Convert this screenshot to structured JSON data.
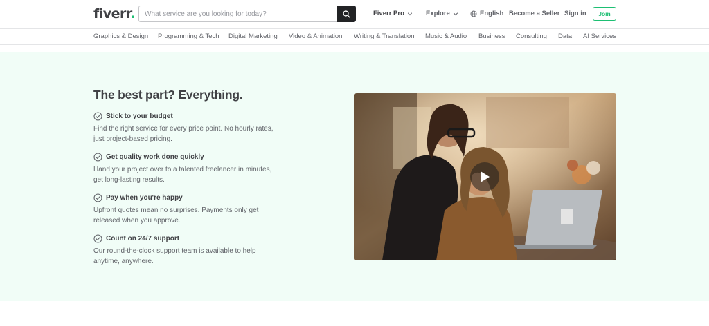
{
  "header": {
    "logo_text": "fiverr",
    "logo_dot": ".",
    "search": {
      "placeholder": "What service are you looking for today?",
      "value": ""
    },
    "nav": {
      "fiverr_pro": "Fiverr Pro",
      "explore": "Explore",
      "language": "English",
      "become_seller": "Become a Seller",
      "sign_in": "Sign in",
      "join": "Join"
    }
  },
  "categories": [
    "Graphics & Design",
    "Programming & Tech",
    "Digital Marketing",
    "Video & Animation",
    "Writing & Translation",
    "Music & Audio",
    "Business",
    "Consulting",
    "Data",
    "AI Services"
  ],
  "hero": {
    "title": "The best part? Everything.",
    "features": [
      {
        "title": "Stick to your budget",
        "desc": "Find the right service for every price point. No hourly rates, just project-based pricing."
      },
      {
        "title": "Get quality work done quickly",
        "desc": "Hand your project over to a talented freelancer in minutes, get long-lasting results."
      },
      {
        "title": "Pay when you're happy",
        "desc": "Upfront quotes mean no surprises. Payments only get released when you approve."
      },
      {
        "title": "Count on 24/7 support",
        "desc": "Our round-the-clock support team is available to help anytime, anywhere."
      }
    ]
  },
  "colors": {
    "brand_green": "#1dbf73",
    "hero_bg": "#f1fdf7",
    "text_dark": "#404145",
    "text_muted": "#62646a"
  },
  "icons": {
    "search": "search-icon",
    "chevron": "chevron-down-icon",
    "globe": "globe-icon",
    "check": "check-circle-icon",
    "play": "play-icon"
  }
}
